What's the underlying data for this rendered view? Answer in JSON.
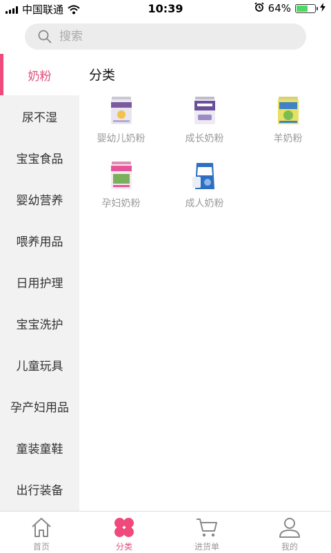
{
  "status_bar": {
    "carrier": "中国联通",
    "time": "10:39",
    "battery": "64%",
    "battery_level": 0.64
  },
  "search": {
    "placeholder": "搜索"
  },
  "sidebar": {
    "items": [
      {
        "label": "奶粉"
      },
      {
        "label": "尿不湿"
      },
      {
        "label": "宝宝食品"
      },
      {
        "label": "婴幼营养"
      },
      {
        "label": "喂养用品"
      },
      {
        "label": "日用护理"
      },
      {
        "label": "宝宝洗护"
      },
      {
        "label": "儿童玩具"
      },
      {
        "label": "孕产妇用品"
      },
      {
        "label": "童装童鞋"
      },
      {
        "label": "出行装备"
      }
    ]
  },
  "content": {
    "title": "分类",
    "categories": [
      {
        "label": "婴幼儿奶粉",
        "icon": "infant-formula-can-icon"
      },
      {
        "label": "成长奶粉",
        "icon": "growth-formula-can-icon"
      },
      {
        "label": "羊奶粉",
        "icon": "goat-milk-can-icon"
      },
      {
        "label": "孕妇奶粉",
        "icon": "maternal-formula-can-icon"
      },
      {
        "label": "成人奶粉",
        "icon": "adult-milk-bag-icon"
      }
    ]
  },
  "tabbar": {
    "tabs": [
      {
        "label": "首页",
        "icon": "home-icon"
      },
      {
        "label": "分类",
        "icon": "clover-icon"
      },
      {
        "label": "进货单",
        "icon": "cart-icon"
      },
      {
        "label": "我的",
        "icon": "user-icon"
      }
    ]
  },
  "colors": {
    "accent": "#ef4a7b",
    "sidebar_bg": "#f2f2f2",
    "label_gray": "#999999"
  }
}
